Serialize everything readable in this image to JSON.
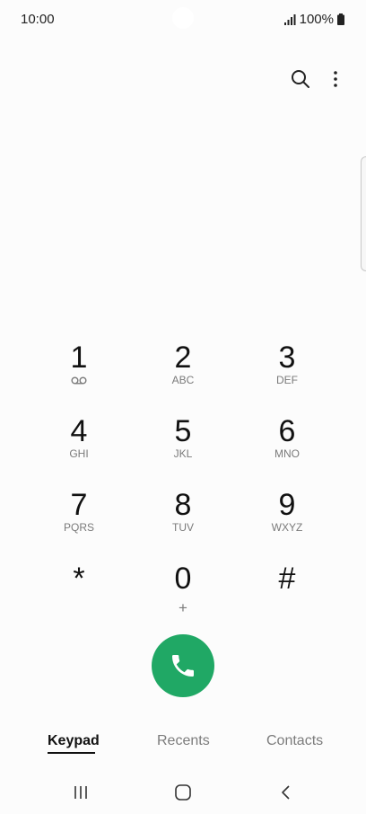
{
  "status_bar": {
    "time": "10:00",
    "battery_percent": "100%",
    "signal_icon": "signal-bars-icon",
    "battery_icon": "battery-full-icon"
  },
  "toolbar": {
    "search_icon": "search-icon",
    "more_icon": "more-vertical-icon"
  },
  "keypad": {
    "keys": [
      {
        "digit": "1",
        "letters": "",
        "icon": "voicemail-icon"
      },
      {
        "digit": "2",
        "letters": "ABC"
      },
      {
        "digit": "3",
        "letters": "DEF"
      },
      {
        "digit": "4",
        "letters": "GHI"
      },
      {
        "digit": "5",
        "letters": "JKL"
      },
      {
        "digit": "6",
        "letters": "MNO"
      },
      {
        "digit": "7",
        "letters": "PQRS"
      },
      {
        "digit": "8",
        "letters": "TUV"
      },
      {
        "digit": "9",
        "letters": "WXYZ"
      },
      {
        "digit": "*",
        "letters": ""
      },
      {
        "digit": "0",
        "letters": "+"
      },
      {
        "digit": "#",
        "letters": ""
      }
    ]
  },
  "call_button": {
    "icon": "phone-icon",
    "color": "#20a865"
  },
  "tabs": [
    {
      "label": "Keypad",
      "selected": true
    },
    {
      "label": "Recents",
      "selected": false
    },
    {
      "label": "Contacts",
      "selected": false
    }
  ],
  "navbar": {
    "recent_icon": "recent-apps-icon",
    "home_icon": "home-icon",
    "back_icon": "back-icon"
  }
}
